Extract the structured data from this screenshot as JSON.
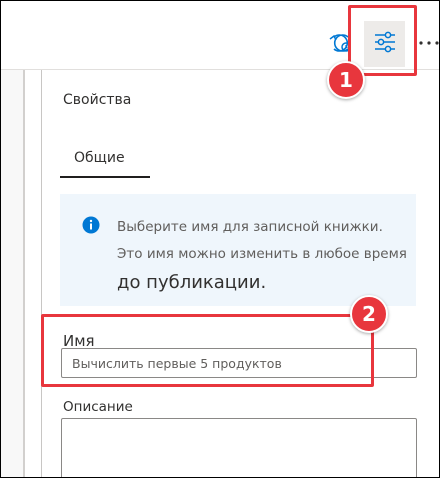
{
  "toolbar": {
    "icons": [
      "sync-icon",
      "properties-sliders-icon",
      "more-options-icon"
    ],
    "more_label": "..."
  },
  "properties_panel": {
    "title": "Свойства",
    "tabs": [
      {
        "label": "Общие",
        "selected": true
      }
    ],
    "info": {
      "icon": "info-icon",
      "line1": "Выберите имя для записной книжки.",
      "line2": "Это имя можно изменить в любое время",
      "line3": "до публикации."
    },
    "name_field": {
      "label": "Имя",
      "value": "Вычислить первые 5 продуктов"
    },
    "description_field": {
      "label": "Описание",
      "value": ""
    }
  },
  "callouts": [
    {
      "number": "1",
      "target": "properties-toggle-button"
    },
    {
      "number": "2",
      "target": "name-field"
    }
  ],
  "colors": {
    "accent": "#0078d4",
    "callout": "#e8363d",
    "info_background": "#eff6fc"
  }
}
